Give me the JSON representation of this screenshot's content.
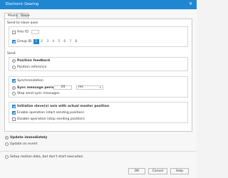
{
  "window": {
    "title": "Electronic Gearing",
    "close_glyph": "✕"
  },
  "tabs": [
    "Master",
    "Slave"
  ],
  "send_group": {
    "label": "Send to slave axes",
    "axis_id_label": "Axis ID",
    "axis_id_value": "",
    "group_id_label": "Group ID",
    "group_numbers": [
      "1",
      "2",
      "3",
      "4",
      "5",
      "6",
      "7",
      "8"
    ],
    "selected_group": "1"
  },
  "send_type": {
    "label": "Send",
    "options": [
      "Position feedback",
      "Position reference"
    ],
    "selected": 0
  },
  "sync_group": {
    "sync_label": "Synchronization",
    "period_label": "Sync message period",
    "period_value": "20",
    "period_unit": "ms",
    "stop_label": "Stop send sync messages"
  },
  "init_group": {
    "items": [
      "Initialize slave(s) axis with actual master position",
      "Enable operation (start sending position)",
      "Disable operation (stop sending position)"
    ]
  },
  "update": {
    "options": [
      "Update immediately",
      "Update on event"
    ],
    "selected": 0
  },
  "setup_only": {
    "label": "Setup motion data, but don't start execution"
  },
  "buttons": {
    "ok": "OK",
    "cancel": "Cancel",
    "help": "Help"
  },
  "colors": {
    "accent": "#1f86d2",
    "title_bar": "#1f86d2"
  }
}
